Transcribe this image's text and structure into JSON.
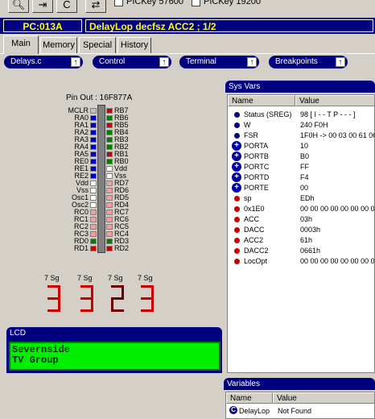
{
  "toolbar": {
    "buttons": [
      {
        "icon": "zoom-icon"
      },
      {
        "icon": "step-icon"
      },
      {
        "icon": "c-icon",
        "label": "C"
      },
      {
        "icon": "link-icon"
      }
    ],
    "checkbox1_label": "PICKey 57600",
    "checkbox2_label": "PICKey 19200"
  },
  "status": {
    "pc": "PC:013A",
    "instruction": "DelayLop decfsz ACC2 ; 1/2"
  },
  "tabs": [
    "Main",
    "Memory",
    "Special",
    "History"
  ],
  "active_tab": "Main",
  "dropdowns": [
    {
      "label": "Delays.c"
    },
    {
      "label": "Control"
    },
    {
      "label": "Terminal"
    },
    {
      "label": "Breakpoints"
    }
  ],
  "chip": {
    "title": "Pin Out : 16F877A",
    "left_pins": [
      {
        "name": "MCLR",
        "color": "#c0c0c0"
      },
      {
        "name": "RA0",
        "color": "#0000cc"
      },
      {
        "name": "RA1",
        "color": "#0000cc"
      },
      {
        "name": "RA2",
        "color": "#0000cc"
      },
      {
        "name": "RA3",
        "color": "#0000cc"
      },
      {
        "name": "RA4",
        "color": "#0000cc"
      },
      {
        "name": "RA5",
        "color": "#0000cc"
      },
      {
        "name": "RE0",
        "color": "#0000cc"
      },
      {
        "name": "RE1",
        "color": "#0000cc"
      },
      {
        "name": "RE2",
        "color": "#0000cc"
      },
      {
        "name": "Vdd",
        "color": "#ffffff"
      },
      {
        "name": "Vss",
        "color": "#ffffff"
      },
      {
        "name": "Osc1",
        "color": "#ffffff"
      },
      {
        "name": "Osc2",
        "color": "#ffffff"
      },
      {
        "name": "RC0",
        "color": "#f0a0a0"
      },
      {
        "name": "RC1",
        "color": "#f0a0a0"
      },
      {
        "name": "RC2",
        "color": "#f0a0a0"
      },
      {
        "name": "RC3",
        "color": "#f0a0a0"
      },
      {
        "name": "RD0",
        "color": "#008000"
      },
      {
        "name": "RD1",
        "color": "#cc0000"
      }
    ],
    "right_pins": [
      {
        "name": "RB7",
        "color": "#cc0000"
      },
      {
        "name": "RB6",
        "color": "#008000"
      },
      {
        "name": "RB5",
        "color": "#cc0000"
      },
      {
        "name": "RB4",
        "color": "#008000"
      },
      {
        "name": "RB3",
        "color": "#008000"
      },
      {
        "name": "RB2",
        "color": "#008000"
      },
      {
        "name": "RB1",
        "color": "#cc0000"
      },
      {
        "name": "RB0",
        "color": "#008000"
      },
      {
        "name": "Vdd",
        "color": "#ffffff"
      },
      {
        "name": "Vss",
        "color": "#ffffff"
      },
      {
        "name": "RD7",
        "color": "#f0a0a0"
      },
      {
        "name": "RD6",
        "color": "#f0a0a0"
      },
      {
        "name": "RD5",
        "color": "#f0a0a0"
      },
      {
        "name": "RD4",
        "color": "#f0a0a0"
      },
      {
        "name": "RC7",
        "color": "#f0a0a0"
      },
      {
        "name": "RC6",
        "color": "#f0a0a0"
      },
      {
        "name": "RC5",
        "color": "#f0a0a0"
      },
      {
        "name": "RC4",
        "color": "#f0a0a0"
      },
      {
        "name": "RD3",
        "color": "#008000"
      },
      {
        "name": "RD2",
        "color": "#cc0000"
      }
    ]
  },
  "seven_segments": [
    {
      "label": "7 Sg",
      "digit": "3",
      "color": "#cc0000"
    },
    {
      "label": "7 Sg",
      "digit": "3",
      "color": "#cc0000"
    },
    {
      "label": "7 Sg",
      "digit": "2",
      "color": "#6b0000"
    },
    {
      "label": "7 Sg",
      "digit": "3",
      "color": "#cc0000"
    }
  ],
  "lcd": {
    "title": "LCD",
    "line1": "Severnside",
    "line2": "TV Group"
  },
  "sysvars": {
    "title": "Sys Vars",
    "col_name": "Name",
    "col_value": "Value",
    "rows": [
      {
        "icon": "blue-dot",
        "name": "Status (SREG)",
        "value": "98 [ I - - T P - - - ]"
      },
      {
        "icon": "blue-dot",
        "name": "W",
        "value": "240 F0H"
      },
      {
        "icon": "blue-dot",
        "name": "FSR",
        "value": "1F0H -> 00 03 00 61 06 0"
      },
      {
        "icon": "plus-icon",
        "name": "PORTA",
        "value": "10"
      },
      {
        "icon": "plus-icon",
        "name": "PORTB",
        "value": "B0"
      },
      {
        "icon": "plus-icon",
        "name": "PORTC",
        "value": "FF"
      },
      {
        "icon": "plus-icon",
        "name": "PORTD",
        "value": "F4"
      },
      {
        "icon": "plus-icon",
        "name": "PORTE",
        "value": "00"
      },
      {
        "icon": "red-dot",
        "name": "sp",
        "value": "EDh"
      },
      {
        "icon": "red-dot",
        "name": "0x1E0",
        "value": "00 00 00 00 00 00 00 00 0"
      },
      {
        "icon": "red-dot",
        "name": "ACC",
        "value": "03h"
      },
      {
        "icon": "red-dot",
        "name": "DACC",
        "value": "0003h"
      },
      {
        "icon": "red-dot",
        "name": "ACC2",
        "value": "61h"
      },
      {
        "icon": "red-dot",
        "name": "DACC2",
        "value": "0661h"
      },
      {
        "icon": "red-dot",
        "name": "LocOpt",
        "value": "00 00 00 00 00 00 00 00 0"
      }
    ]
  },
  "variables": {
    "title": "Variables",
    "col_name": "Name",
    "col_value": "Value",
    "rows": [
      {
        "icon": "c-icon",
        "name": "DelayLop",
        "value": "Not Found"
      }
    ]
  }
}
